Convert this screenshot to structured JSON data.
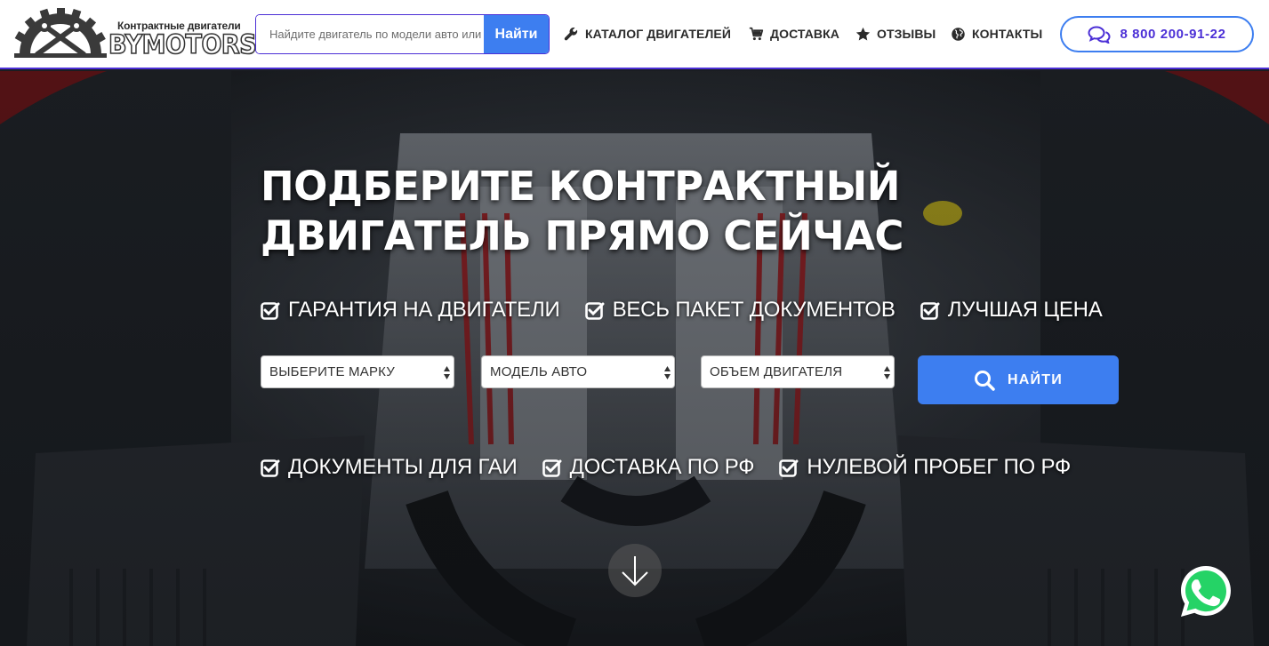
{
  "header": {
    "logo": {
      "small": "Контрактные двигатели",
      "big": "BYMOTORS"
    },
    "search": {
      "placeholder": "Найдите двигатель по модели авто или номеру",
      "button": "Найти"
    },
    "nav": [
      {
        "label": "КАТАЛОГ ДВИГАТЕЛЕЙ",
        "icon": "wrench-icon"
      },
      {
        "label": "ДОСТАВКА",
        "icon": "cart-icon"
      },
      {
        "label": "ОТЗЫВЫ",
        "icon": "star-icon"
      },
      {
        "label": "КОНТАКТЫ",
        "icon": "globe-icon"
      }
    ],
    "phone": "8 800 200-91-22"
  },
  "hero": {
    "title_line1": "ПОДБЕРИТЕ КОНТРАКТНЫЙ",
    "title_line2": "ДВИГАТЕЛЬ ПРЯМО СЕЙЧАС",
    "features_top": [
      "ГАРАНТИЯ НА ДВИГАТЕЛИ",
      "ВЕСЬ ПАКЕТ ДОКУМЕНТОВ",
      "ЛУЧШАЯ ЦЕНА"
    ],
    "selects": {
      "brand": "ВЫБЕРИТЕ МАРКУ",
      "model": "МОДЕЛЬ АВТО",
      "volume": "ОБЪЕМ ДВИГАТЕЛЯ"
    },
    "find_button": "НАЙТИ",
    "features_bottom": [
      "ДОКУМЕНТЫ ДЛЯ ГАИ",
      "ДОСТАВКА ПО РФ",
      "НУЛЕВОЙ ПРОБЕГ ПО РФ"
    ]
  },
  "colors": {
    "accent": "#3d7ef0",
    "brand_purple": "#4b2fd6",
    "whatsapp": "#25d366"
  }
}
